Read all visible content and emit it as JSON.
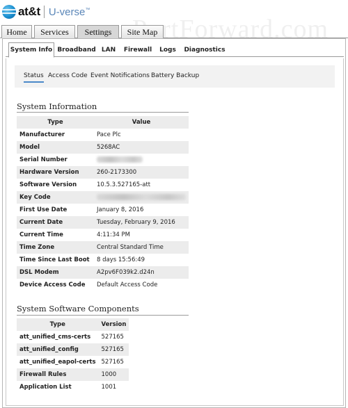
{
  "brand": {
    "logo_text": "at&t",
    "product": "U-verse",
    "trademark": "™",
    "watermark": "PortForward.com"
  },
  "top_tabs": [
    {
      "label": "Home",
      "active": false
    },
    {
      "label": "Services",
      "active": false
    },
    {
      "label": "Settings",
      "active": true
    },
    {
      "label": "Site Map",
      "active": false
    }
  ],
  "sub_tabs": [
    {
      "label": "System Info",
      "active": true
    },
    {
      "label": "Broadband",
      "active": false
    },
    {
      "label": "LAN",
      "active": false
    },
    {
      "label": "Firewall",
      "active": false
    },
    {
      "label": "Logs",
      "active": false
    },
    {
      "label": "Diagnostics",
      "active": false
    }
  ],
  "section_nav": [
    {
      "label": "Status",
      "active": true
    },
    {
      "label": "Access Code",
      "active": false
    },
    {
      "label": "Event Notifications",
      "active": false
    },
    {
      "label": "Battery Backup",
      "active": false
    }
  ],
  "system_information": {
    "title": "System Information",
    "headers": {
      "type": "Type",
      "value": "Value"
    },
    "rows": [
      {
        "type": "Manufacturer",
        "value": "Pace Plc"
      },
      {
        "type": "Model",
        "value": "5268AC"
      },
      {
        "type": "Serial Number",
        "value": "",
        "redacted": true
      },
      {
        "type": "Hardware Version",
        "value": "260-2173300"
      },
      {
        "type": "Software Version",
        "value": "10.5.3.527165-att"
      },
      {
        "type": "Key Code",
        "value": "",
        "redacted": true
      },
      {
        "type": "First Use Date",
        "value": "January 8, 2016"
      },
      {
        "type": "Current Date",
        "value": "Tuesday, February 9, 2016"
      },
      {
        "type": "Current Time",
        "value": "4:11:34 PM"
      },
      {
        "type": "Time Zone",
        "value": "Central Standard Time"
      },
      {
        "type": "Time Since Last Boot",
        "value": "8 days 15:56:49"
      },
      {
        "type": "DSL Modem",
        "value": "A2pv6F039k2.d24n"
      },
      {
        "type": "Device Access Code",
        "value": "Default Access Code"
      }
    ]
  },
  "software_components": {
    "title": "System Software Components",
    "headers": {
      "type": "Type",
      "version": "Version"
    },
    "rows": [
      {
        "type": "att_unified_cms-certs",
        "version": "527165"
      },
      {
        "type": "att_unified_config",
        "version": "527165"
      },
      {
        "type": "att_unified_eapol-certs",
        "version": "527165"
      },
      {
        "type": "Firewall Rules",
        "version": "1000"
      },
      {
        "type": "Application List",
        "version": "1001"
      }
    ]
  }
}
